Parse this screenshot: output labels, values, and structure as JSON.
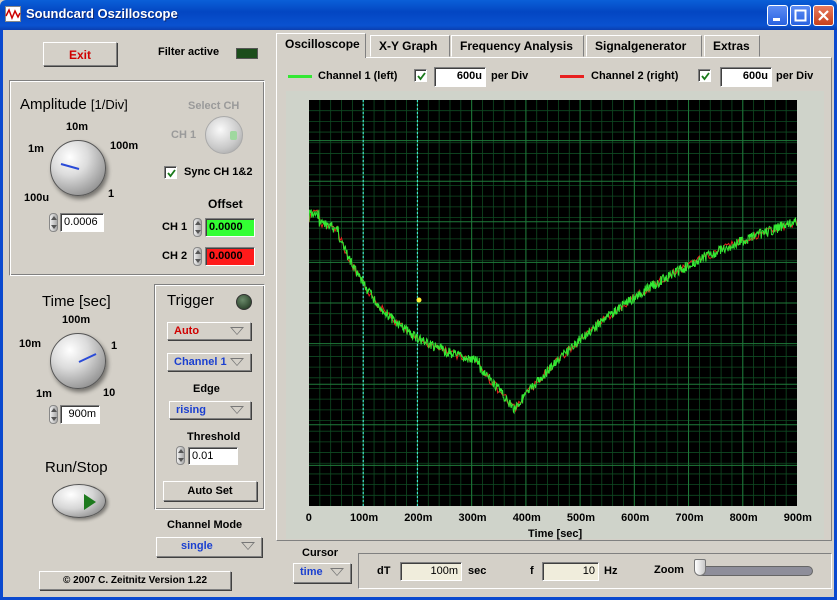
{
  "window": {
    "title": "Soundcard Oszilloscope"
  },
  "left": {
    "exit_label": "Exit",
    "filter_label": "Filter active",
    "amplitude": {
      "title": "Amplitude",
      "unit": "[1/Div]",
      "scale": [
        "100u",
        "1m",
        "10m",
        "100m",
        "1"
      ],
      "value": "0.0006"
    },
    "select_ch": {
      "label": "Select CH",
      "ch_label": "CH 1"
    },
    "sync_label": "Sync CH 1&2",
    "offset": {
      "title": "Offset",
      "ch1_label": "CH 1",
      "ch1_value": "0.0000",
      "ch2_label": "CH 2",
      "ch2_value": "0.0000"
    },
    "time": {
      "title": "Time [sec]",
      "scale": [
        "1m",
        "10m",
        "100m",
        "1",
        "10"
      ],
      "value": "900m"
    },
    "trigger": {
      "title": "Trigger",
      "mode": "Auto",
      "channel": "Channel 1",
      "edge_label": "Edge",
      "edge": "rising",
      "threshold_label": "Threshold",
      "threshold": "0.01",
      "autoset_label": "Auto Set"
    },
    "run_stop_label": "Run/Stop",
    "channel_mode": {
      "label": "Channel Mode",
      "value": "single"
    },
    "copyright": "© 2007  C. Zeitnitz Version 1.22"
  },
  "tabs": [
    "Oscilloscope",
    "X-Y Graph",
    "Frequency Analysis",
    "Signalgenerator",
    "Extras"
  ],
  "channels": {
    "ch1": {
      "label": "Channel 1 (left)",
      "value": "600u",
      "unit": "per Div",
      "color": "#33e833"
    },
    "ch2": {
      "label": "Channel 2 (right)",
      "value": "600u",
      "unit": "per Div",
      "color": "#e82020"
    }
  },
  "plot": {
    "xlabel": "Time [sec]",
    "xticks": [
      "0",
      "100m",
      "200m",
      "300m",
      "400m",
      "500m",
      "600m",
      "700m",
      "800m",
      "900m"
    ],
    "cursor_positions_ms": [
      100,
      200
    ]
  },
  "cursor": {
    "label": "Cursor",
    "mode": "time",
    "dt_label": "dT",
    "dt_value": "100m",
    "dt_unit": "sec",
    "f_label": "f",
    "f_value": "10",
    "f_unit": "Hz",
    "zoom_label": "Zoom"
  },
  "colors": {
    "plot_background": "#000000",
    "grid": "#1f7a3a",
    "cursor": "#40e0d0"
  }
}
